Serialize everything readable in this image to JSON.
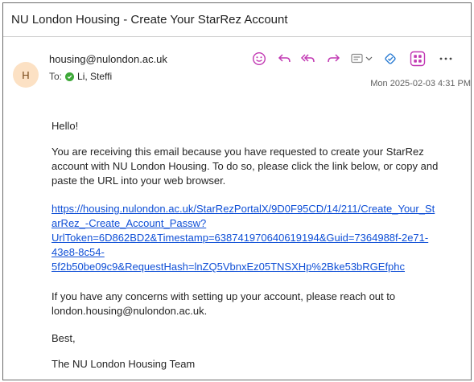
{
  "email": {
    "subject": "NU London Housing - Create Your StarRez Account",
    "avatar_initial": "H",
    "from": "housing@nulondon.ac.uk",
    "to_label": "To:",
    "to_name": "Li, Steffi",
    "date": "Mon 2025-02-03 4:31 PM",
    "greeting": "Hello!",
    "paragraph_1": "You are receiving this email because you have requested to create your StarRez account with NU London Housing. To do so, please click the link below, or copy and paste the URL into your web browser.",
    "link_lines": "https://housing.nulondon.ac.uk/StarRezPortalX/9D0F95CD/14/211/Create_Your_St\narRez_-Create_Account_Passw?\nUrlToken=6D862BD2&Timestamp=638741970640619194&Guid=7364988f-2e71-\n43e8-8c54-\n5f2b50be09c9&RequestHash=lnZQ5VbnxEz05TNSXHp%2Bke53bRGEfphc",
    "paragraph_2": "If you have any concerns with setting up your account, please reach out to london.housing@nulondon.ac.uk.",
    "signoff": "Best,",
    "signature": "The NU London Housing Team"
  },
  "toolbar": {
    "icons": [
      "emoji-react-icon",
      "reply-icon",
      "reply-all-icon",
      "forward-icon",
      "immersive-reader-icon",
      "chevron-down-icon",
      "rules-icon",
      "apps-icon",
      "more-icon"
    ]
  },
  "colors": {
    "accent": "#c239b3",
    "link": "#0f4fd6",
    "avatar_bg": "#fce1c4",
    "presence": "#3da838"
  }
}
